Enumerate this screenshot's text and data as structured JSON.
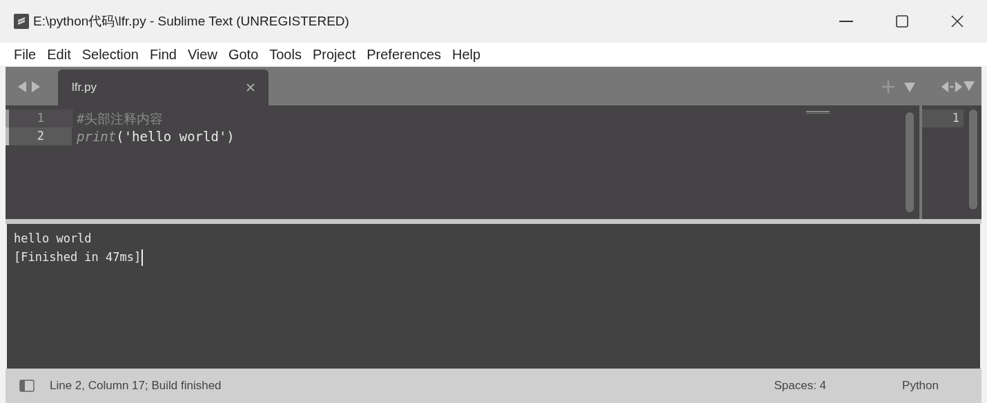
{
  "window": {
    "title": "E:\\python代码\\lfr.py - Sublime Text (UNREGISTERED)"
  },
  "menu": [
    "File",
    "Edit",
    "Selection",
    "Find",
    "View",
    "Goto",
    "Tools",
    "Project",
    "Preferences",
    "Help"
  ],
  "tabs": [
    {
      "label": "lfr.py",
      "selected": true
    }
  ],
  "editor": {
    "lines": [
      {
        "number": "1",
        "current": false,
        "tokens": [
          {
            "kind": "comment",
            "text": "#头部注释内容"
          }
        ]
      },
      {
        "number": "2",
        "current": true,
        "tokens": [
          {
            "kind": "function",
            "text": "print"
          },
          {
            "kind": "plain",
            "text": "('hello world')"
          }
        ]
      }
    ]
  },
  "second_pane": {
    "line_number": "1"
  },
  "output": {
    "lines": [
      "hello world",
      "[Finished in 47ms]"
    ]
  },
  "status_bar": {
    "message": "Line 2, Column 17; Build finished",
    "indentation": "Spaces: 4",
    "syntax": "Python"
  }
}
